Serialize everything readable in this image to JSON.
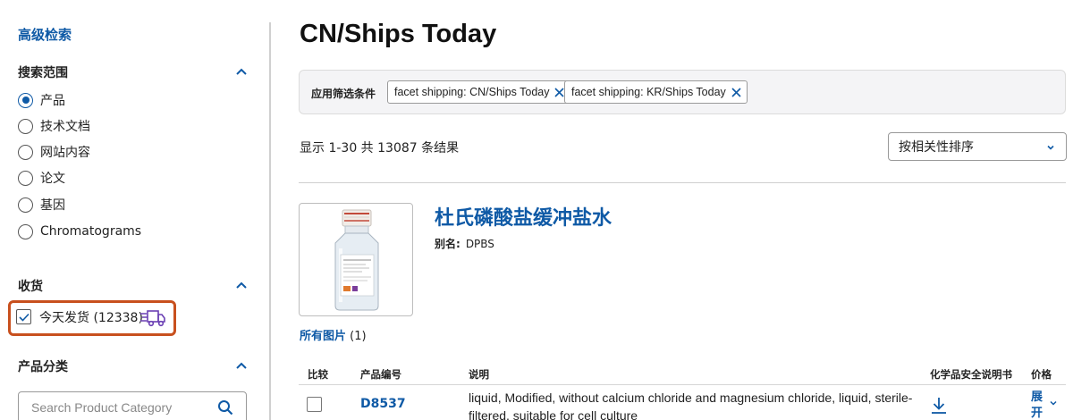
{
  "sidebar": {
    "advanced_search": "高级检索",
    "scope": {
      "title": "搜索范围",
      "options": [
        {
          "label": "产品",
          "checked": true
        },
        {
          "label": "技术文档",
          "checked": false
        },
        {
          "label": "网站内容",
          "checked": false
        },
        {
          "label": "论文",
          "checked": false
        },
        {
          "label": "基因",
          "checked": false
        },
        {
          "label": "Chromatograms",
          "checked": false
        }
      ]
    },
    "shipping": {
      "title": "收货",
      "option_label": "今天发货 (12338)",
      "checked": true,
      "highlight_color": "#c8501e"
    },
    "category": {
      "title": "产品分类",
      "search_placeholder": "Search Product Category"
    }
  },
  "main": {
    "title": "CN/Ships Today",
    "filters": {
      "label": "应用筛选条件",
      "chips": [
        "facet shipping: CN/Ships Today",
        "facet shipping: KR/Ships Today"
      ]
    },
    "results_text": "显示 1-30 共 13087 条结果",
    "sort_selected": "按相关性排序",
    "product": {
      "title": "杜氏磷酸盐缓冲盐水",
      "alias_label": "别名:",
      "alias_value": "DPBS",
      "all_images_label": "所有图片",
      "all_images_count": "(1)",
      "table_headers": {
        "compare": "比较",
        "product_number": "产品编号",
        "description": "说明",
        "sds": "化学品安全说明书",
        "price": "价格"
      },
      "rows": [
        {
          "sku": "D8537",
          "description": "liquid, Modified, without calcium chloride and magnesium chloride, liquid, sterile-filtered, suitable for cell culture",
          "price_action": "展开"
        }
      ]
    }
  },
  "colors": {
    "link_blue": "#0f5aa6",
    "accent_orange": "#c8501e",
    "truck_purple": "#6a3fb3"
  }
}
